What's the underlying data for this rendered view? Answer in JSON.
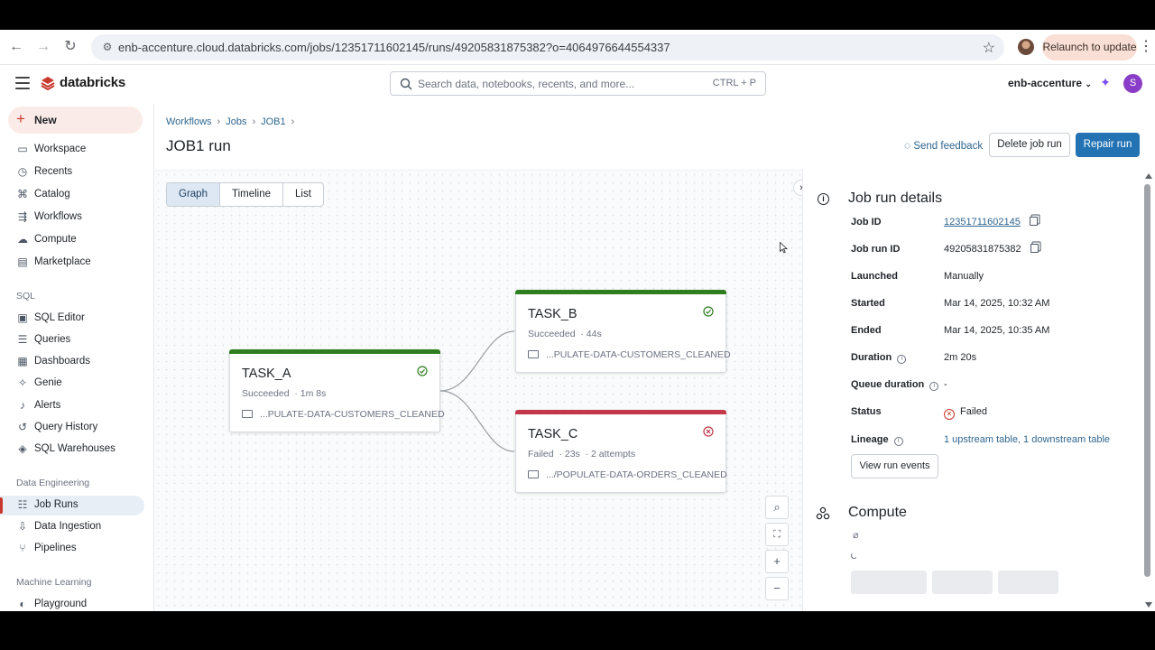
{
  "browser": {
    "url": "enb-accenture.cloud.databricks.com/jobs/12351711602145/runs/49205831875382?o=4064976644554337",
    "relaunch_label": "Relaunch to update"
  },
  "header": {
    "brand": "databricks",
    "search_placeholder": "Search data, notebooks, recents, and more...",
    "search_shortcut": "CTRL + P",
    "workspace_name": "enb-accenture",
    "user_initial": "S",
    "brand_color": "#c9382c",
    "primary_color": "#2272b4"
  },
  "sidebar": {
    "new_label": "New",
    "items_top": [
      {
        "label": "Workspace",
        "icon": "folder-icon"
      },
      {
        "label": "Recents",
        "icon": "clock-icon"
      },
      {
        "label": "Catalog",
        "icon": "catalog-icon"
      },
      {
        "label": "Workflows",
        "icon": "workflows-icon"
      },
      {
        "label": "Compute",
        "icon": "cloud-icon"
      },
      {
        "label": "Marketplace",
        "icon": "store-icon"
      }
    ],
    "sql_section": "SQL",
    "items_sql": [
      {
        "label": "SQL Editor",
        "icon": "editor-icon"
      },
      {
        "label": "Queries",
        "icon": "queries-icon"
      },
      {
        "label": "Dashboards",
        "icon": "dashboard-icon"
      },
      {
        "label": "Genie",
        "icon": "genie-icon"
      },
      {
        "label": "Alerts",
        "icon": "bell-icon"
      },
      {
        "label": "Query History",
        "icon": "history-icon"
      },
      {
        "label": "SQL Warehouses",
        "icon": "warehouse-icon"
      }
    ],
    "de_section": "Data Engineering",
    "items_de": [
      {
        "label": "Job Runs",
        "icon": "list-icon",
        "active": true
      },
      {
        "label": "Data Ingestion",
        "icon": "ingest-icon"
      },
      {
        "label": "Pipelines",
        "icon": "pipeline-icon"
      }
    ],
    "ml_section": "Machine Learning",
    "items_ml": [
      {
        "label": "Playground",
        "icon": "playground-icon"
      }
    ]
  },
  "main": {
    "breadcrumb": [
      "Workflows",
      "Jobs",
      "JOB1"
    ],
    "title": "JOB1 run",
    "send_feedback": "Send feedback",
    "delete_label": "Delete job run",
    "repair_label": "Repair run",
    "tabs": [
      "Graph",
      "Timeline",
      "List"
    ],
    "selected_tab": "Graph"
  },
  "tasks": [
    {
      "name": "TASK_A",
      "status": "Succeeded",
      "meta": "1m 8s",
      "path": "...PULATE-DATA-CUSTOMERS_CLEANED",
      "color": "#2e7d1e"
    },
    {
      "name": "TASK_B",
      "status": "Succeeded",
      "meta": "44s",
      "path": "...PULATE-DATA-CUSTOMERS_CLEANED",
      "color": "#2e7d1e"
    },
    {
      "name": "TASK_C",
      "status": "Failed",
      "meta": "23s",
      "attempts": "2 attempts",
      "path": ".../POPULATE-DATA-ORDERS_CLEANED",
      "color": "#c4374a"
    }
  ],
  "details": {
    "title": "Job run details",
    "rows": {
      "job_id": {
        "k": "Job ID",
        "v": "12351711602145"
      },
      "run_id": {
        "k": "Job run ID",
        "v": "49205831875382"
      },
      "launched": {
        "k": "Launched",
        "v": "Manually"
      },
      "started": {
        "k": "Started",
        "v": "Mar 14, 2025, 10:32 AM"
      },
      "ended": {
        "k": "Ended",
        "v": "Mar 14, 2025, 10:35 AM"
      },
      "duration": {
        "k": "Duration",
        "v": "2m 20s"
      },
      "queue": {
        "k": "Queue duration",
        "v": "-"
      },
      "status": {
        "k": "Status",
        "v": "Failed"
      },
      "lineage": {
        "k": "Lineage",
        "v": "1 upstream table, 1 downstream table"
      }
    },
    "view_events": "View run events",
    "compute_title": "Compute"
  }
}
